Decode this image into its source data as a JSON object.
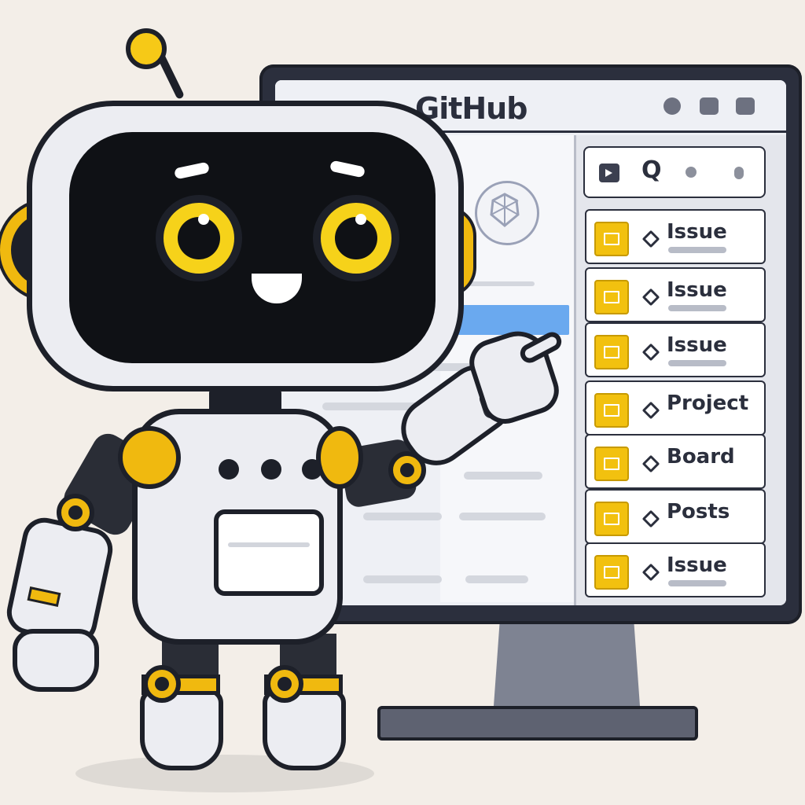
{
  "monitor": {
    "app_title": "GitHub",
    "list_items": [
      {
        "label": "Issue"
      },
      {
        "label": "Issue"
      },
      {
        "label": "Issue"
      },
      {
        "label": "Project"
      },
      {
        "label": "Board"
      },
      {
        "label": "Posts"
      },
      {
        "label": "Issue"
      }
    ]
  },
  "icons": {
    "window_controls": [
      "minimize-icon",
      "maximize-icon",
      "close-icon"
    ],
    "search": "search-icon",
    "list_item_icon": "folder-icon",
    "list_item_marker": "diamond-icon"
  },
  "colors": {
    "accent_yellow": "#f0b90f",
    "outline": "#1d2029",
    "highlight_blue": "#6aa9ef",
    "background": "#f3eee8"
  }
}
